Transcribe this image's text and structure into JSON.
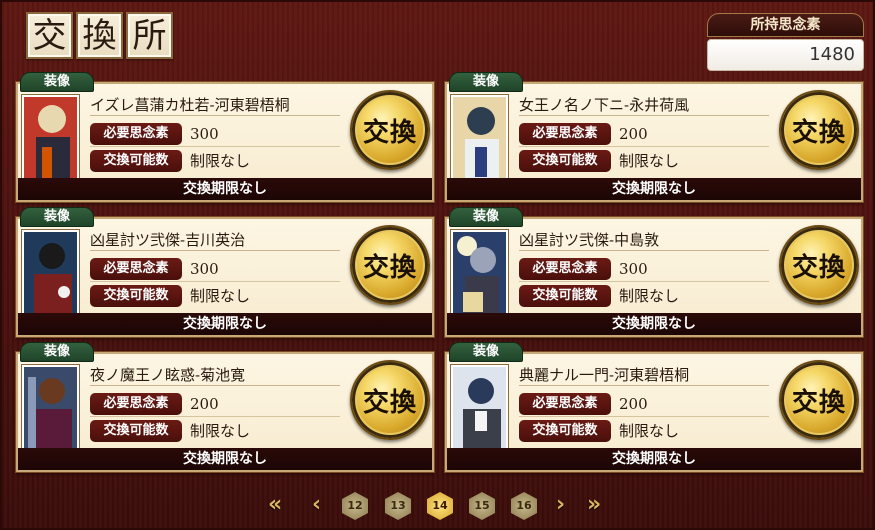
{
  "title": {
    "chars": [
      "交",
      "換",
      "所"
    ]
  },
  "points": {
    "label": "所持思念素",
    "value": "1480"
  },
  "cards": [
    {
      "tag": "装像",
      "name": "イズレ菖蒲カ杜若-河東碧梧桐",
      "cost_label": "必要思念素",
      "cost": "300",
      "limit_label": "交換可能数",
      "limit": "制限なし",
      "period": "交換期限なし",
      "button": "交換"
    },
    {
      "tag": "装像",
      "name": "女王ノ名ノ下ニ-永井荷風",
      "cost_label": "必要思念素",
      "cost": "200",
      "limit_label": "交換可能数",
      "limit": "制限なし",
      "period": "交換期限なし",
      "button": "交換"
    },
    {
      "tag": "装像",
      "name": "凶星討ツ弐傑-吉川英治",
      "cost_label": "必要思念素",
      "cost": "300",
      "limit_label": "交換可能数",
      "limit": "制限なし",
      "period": "交換期限なし",
      "button": "交換"
    },
    {
      "tag": "装像",
      "name": "凶星討ツ弐傑-中島敦",
      "cost_label": "必要思念素",
      "cost": "300",
      "limit_label": "交換可能数",
      "limit": "制限なし",
      "period": "交換期限なし",
      "button": "交換"
    },
    {
      "tag": "装像",
      "name": "夜ノ魔王ノ眩惑-菊池寛",
      "cost_label": "必要思念素",
      "cost": "200",
      "limit_label": "交換可能数",
      "limit": "制限なし",
      "period": "交換期限なし",
      "button": "交換"
    },
    {
      "tag": "装像",
      "name": "典麗ナル一門-河東碧梧桐",
      "cost_label": "必要思念素",
      "cost": "200",
      "limit_label": "交換可能数",
      "limit": "制限なし",
      "period": "交換期限なし",
      "button": "交換"
    }
  ],
  "pager": {
    "first": "«",
    "prev": "‹",
    "next": "›",
    "last": "»",
    "pages": [
      "12",
      "13",
      "14",
      "15",
      "16"
    ],
    "current": "14"
  },
  "colors": {
    "panel_bg": "#4a110e",
    "card_bg": "#fdf6e3",
    "label_red": "#6b1a14",
    "tag_green": "#33613e",
    "gold": "#d9a92c"
  }
}
